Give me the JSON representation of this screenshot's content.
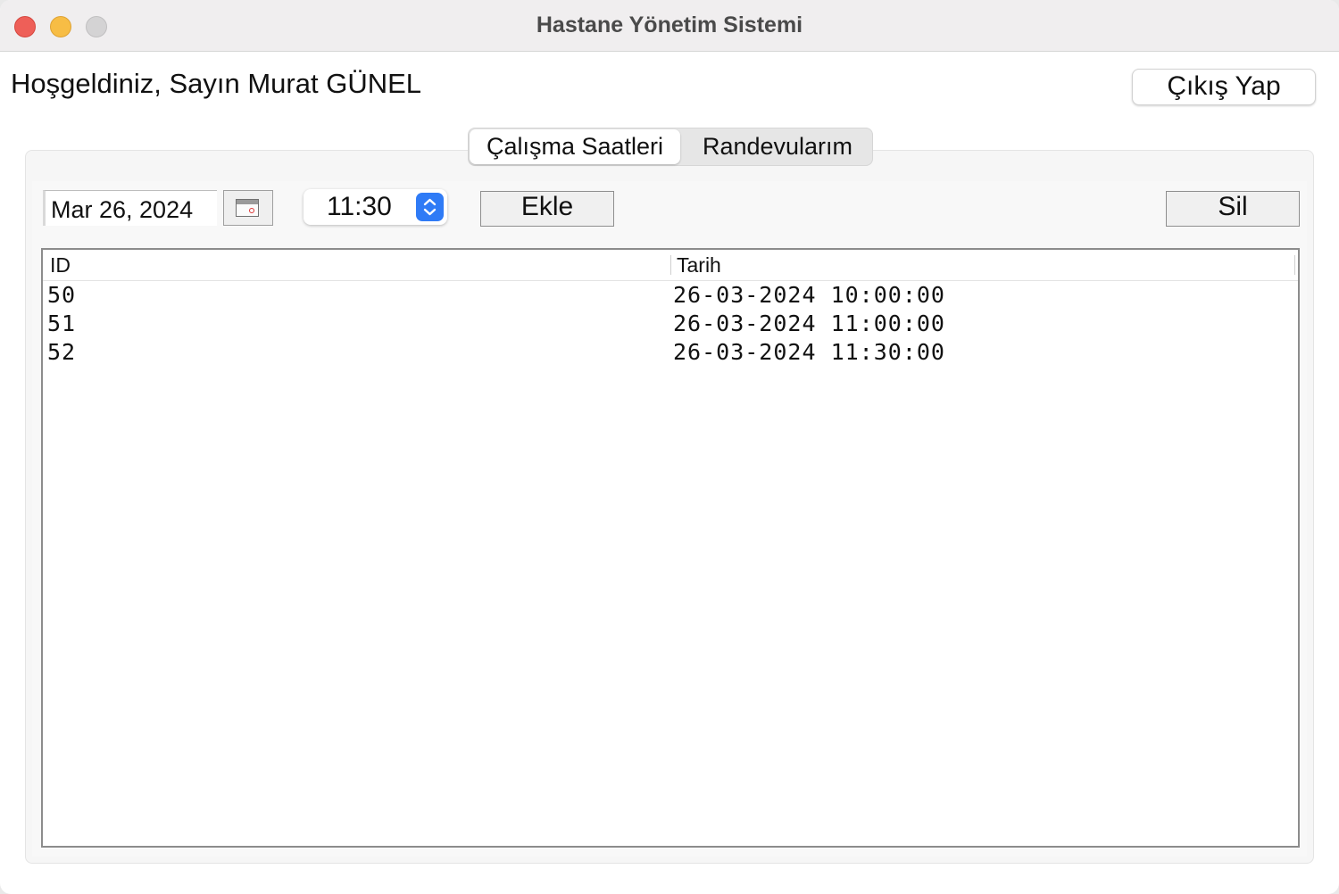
{
  "window": {
    "title": "Hastane Yönetim Sistemi"
  },
  "header": {
    "welcome": "Hoşgeldiniz, Sayın Murat GÜNEL",
    "logout_label": "Çıkış Yap"
  },
  "tabs": [
    {
      "label": "Çalışma Saatleri",
      "active": true
    },
    {
      "label": "Randevularım",
      "active": false
    }
  ],
  "toolbar": {
    "date_value": "Mar 26, 2024",
    "time_value": "11:30",
    "add_label": "Ekle",
    "delete_label": "Sil"
  },
  "table": {
    "columns": [
      "ID",
      "Tarih"
    ],
    "rows": [
      {
        "id": "50",
        "tarih": "26-03-2024 10:00:00"
      },
      {
        "id": "51",
        "tarih": "26-03-2024 11:00:00"
      },
      {
        "id": "52",
        "tarih": "26-03-2024 11:30:00"
      }
    ]
  },
  "colors": {
    "close": "#ee5f58",
    "minimize": "#f7bd45",
    "maximize": "#d4d3d4",
    "accent": "#2f7bf6"
  }
}
